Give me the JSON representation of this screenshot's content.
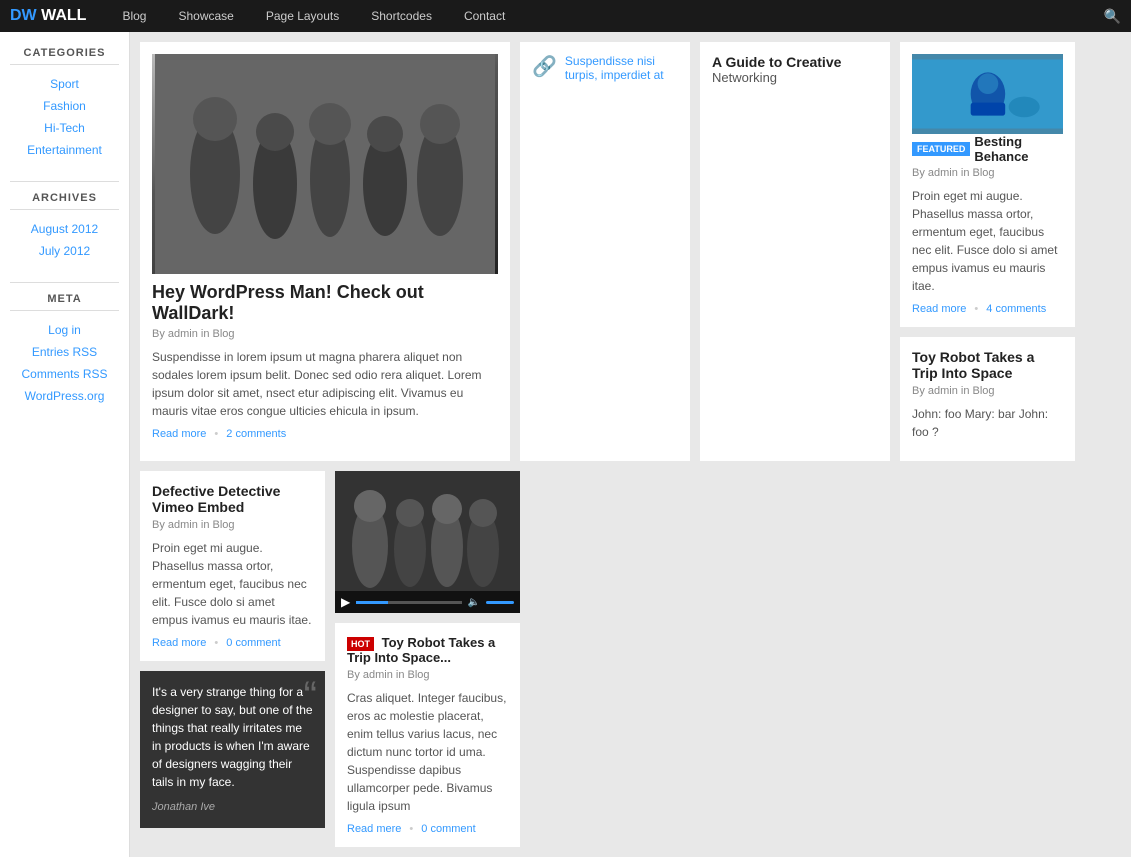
{
  "header": {
    "logo_prefix": "DW",
    "logo_suffix": "WALL",
    "nav_items": [
      "Blog",
      "Showcase",
      "Page Layouts",
      "Shortcodes",
      "Contact"
    ]
  },
  "sidebar": {
    "categories_title": "CATEGORIES",
    "categories": [
      "Sport",
      "Fashion",
      "Hi-Tech",
      "Entertainment"
    ],
    "archives_title": "ARCHIVES",
    "archives": [
      "August 2012",
      "July 2012"
    ],
    "meta_title": "META",
    "meta_links": [
      "Log in",
      "Entries RSS",
      "Comments RSS",
      "WordPress.org"
    ]
  },
  "posts": {
    "featured_large": {
      "title": "Hey WordPress Man! Check out WallDark!",
      "meta": "By admin in Blog",
      "excerpt": "Suspendisse in lorem ipsum ut magna pharera aliquet non sodales lorem ipsum belit. Donec sed odio rera aliquet. Lorem ipsum dolor sit amet, nsect etur adipiscing elit. Vivamus eu mauris vitae eros congue ulticies ehicula in ipsum.",
      "read_more": "Read more",
      "comments": "2 comments"
    },
    "link_post": {
      "text": "Suspendisse nisi turpis, imperdiet at"
    },
    "guide_post": {
      "title": "A Guide to Creative",
      "subtitle": "Networking",
      "full_title": "Guide Creative Networking"
    },
    "besting_behance": {
      "featured_label": "FEATURED",
      "title": "Besting Behance",
      "meta": "By admin in Blog",
      "excerpt": "Proin eget mi augue. Phasellus massa ortor, ermentum eget, faucibus nec elit. Fusce dolo si amet empus ivamus eu mauris itae.",
      "read_more": "Read more",
      "comments": "4 comments"
    },
    "toy_robot_mid": {
      "title": "Toy Robot Takes a Trip Into Space",
      "meta": "By admin in Blog",
      "excerpt": "John: foo Mary: bar John: foo ?"
    },
    "defective_detective": {
      "title": "Defective Detective Vimeo Embed",
      "meta": "By admin in Blog",
      "excerpt": "Proin eget mi augue. Phasellus massa ortor, ermentum eget, faucibus nec elit. Fusce dolo si amet empus ivamus eu mauris itae.",
      "read_more": "Read more",
      "comments": "0 comment"
    },
    "quote": {
      "text": "It's a very strange thing for a designer to say, but one of the things that really irritates me in products is when I'm aware of designers wagging their tails in my face.",
      "author": "Jonathan Ive"
    },
    "toy_robot_right": {
      "hot_label": "HOT",
      "title": "Toy Robot Takes a Trip Into Space...",
      "meta": "By admin in Blog",
      "excerpt": "Cras aliquet. Integer faucibus, eros ac molestie placerat, enim tellus varius lacus, nec dictum nunc tortor id uma. Suspendisse dapibus ullamcorper pede. Bivamus ligula ipsum",
      "read_more": "Read mere",
      "comments": "0 comment"
    }
  }
}
